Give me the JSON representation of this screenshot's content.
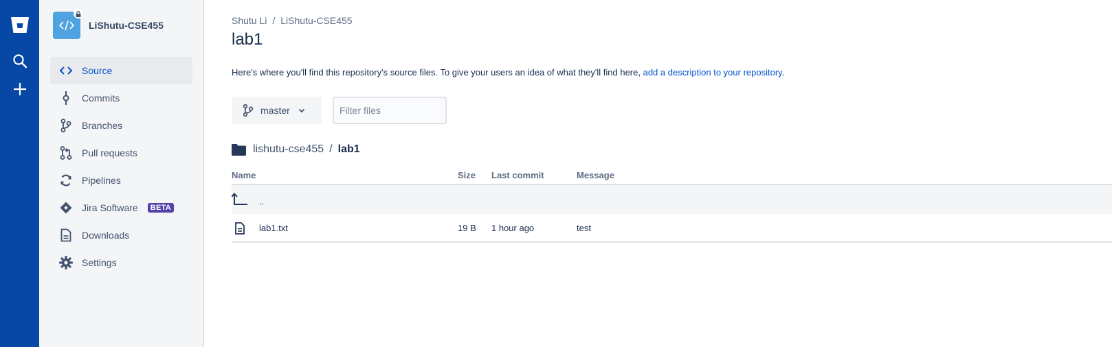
{
  "global_nav": {
    "items": [
      {
        "name": "bitbucket-logo-icon"
      },
      {
        "name": "search-icon"
      },
      {
        "name": "create-plus-icon"
      }
    ]
  },
  "sidebar": {
    "repo_name": "LiShutu-CSE455",
    "items": [
      {
        "label": "Source",
        "icon": "source-code-icon",
        "active": true
      },
      {
        "label": "Commits",
        "icon": "commit-icon"
      },
      {
        "label": "Branches",
        "icon": "branches-icon"
      },
      {
        "label": "Pull requests",
        "icon": "pull-request-icon"
      },
      {
        "label": "Pipelines",
        "icon": "pipelines-icon"
      },
      {
        "label": "Jira Software",
        "icon": "jira-icon",
        "badge": "BETA"
      },
      {
        "label": "Downloads",
        "icon": "downloads-icon"
      },
      {
        "label": "Settings",
        "icon": "gear-icon"
      }
    ]
  },
  "breadcrumb": {
    "owner": "Shutu Li",
    "sep": "/",
    "repo": "LiShutu-CSE455"
  },
  "page_title": "lab1",
  "intro": {
    "text": "Here's where you'll find this repository's source files. To give your users an idea of what they'll find here, ",
    "link": "add a description to your repository",
    "end": "."
  },
  "branch": {
    "label": "master"
  },
  "filter": {
    "placeholder": "Filter files",
    "value": ""
  },
  "path": {
    "root": "lishutu-cse455",
    "sep": "/",
    "current": "lab1"
  },
  "table": {
    "headers": {
      "name": "Name",
      "size": "Size",
      "last_commit": "Last commit",
      "message": "Message"
    },
    "parent": {
      "name": ".."
    },
    "rows": [
      {
        "name": "lab1.txt",
        "size": "19 B",
        "last_commit": "1 hour ago",
        "message": "test"
      }
    ]
  },
  "colors": {
    "global_nav": "#0747a6",
    "sidebar": "#f4f5f7",
    "link": "#0052cc",
    "beta": "#5243aa",
    "repo_avatar": "#4fa3e0"
  }
}
